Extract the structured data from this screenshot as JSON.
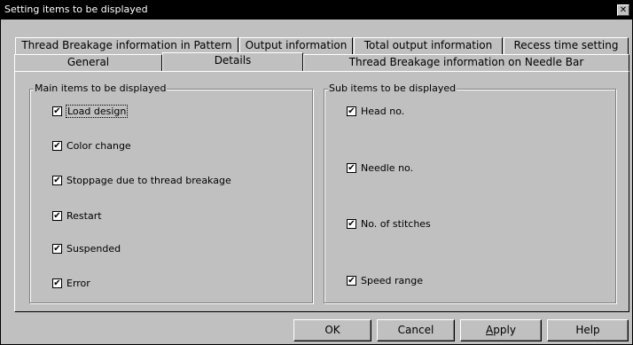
{
  "window": {
    "title": "Setting items to be displayed",
    "close_glyph": "✕"
  },
  "tabs": {
    "row_back": [
      {
        "label": "Thread Breakage information in Pattern"
      },
      {
        "label": "Output information"
      },
      {
        "label": "Total output information"
      },
      {
        "label": "Recess time setting"
      }
    ],
    "row_front": [
      {
        "label": "General"
      },
      {
        "label": "Details",
        "active": true
      },
      {
        "label": "Thread Breakage information on Needle Bar"
      }
    ]
  },
  "main_group": {
    "title": "Main items to be displayed",
    "items": [
      {
        "label": "Load design",
        "checked": true,
        "focused": true
      },
      {
        "label": "Color change",
        "checked": true
      },
      {
        "label": "Stoppage due to thread breakage",
        "checked": true
      },
      {
        "label": "Restart",
        "checked": true
      },
      {
        "label": "Suspended",
        "checked": true
      },
      {
        "label": "Error",
        "checked": true
      }
    ]
  },
  "sub_group": {
    "title": "Sub items to be displayed",
    "items": [
      {
        "label": "Head  no.",
        "checked": true
      },
      {
        "label": "Needle no.",
        "checked": true
      },
      {
        "label": "No. of stitches",
        "checked": true
      },
      {
        "label": "Speed range",
        "checked": true
      }
    ]
  },
  "check_glyph": "✔",
  "buttons": {
    "ok": "OK",
    "cancel": "Cancel",
    "apply_mnemonic": "A",
    "apply_rest": "pply",
    "help": "Help"
  }
}
